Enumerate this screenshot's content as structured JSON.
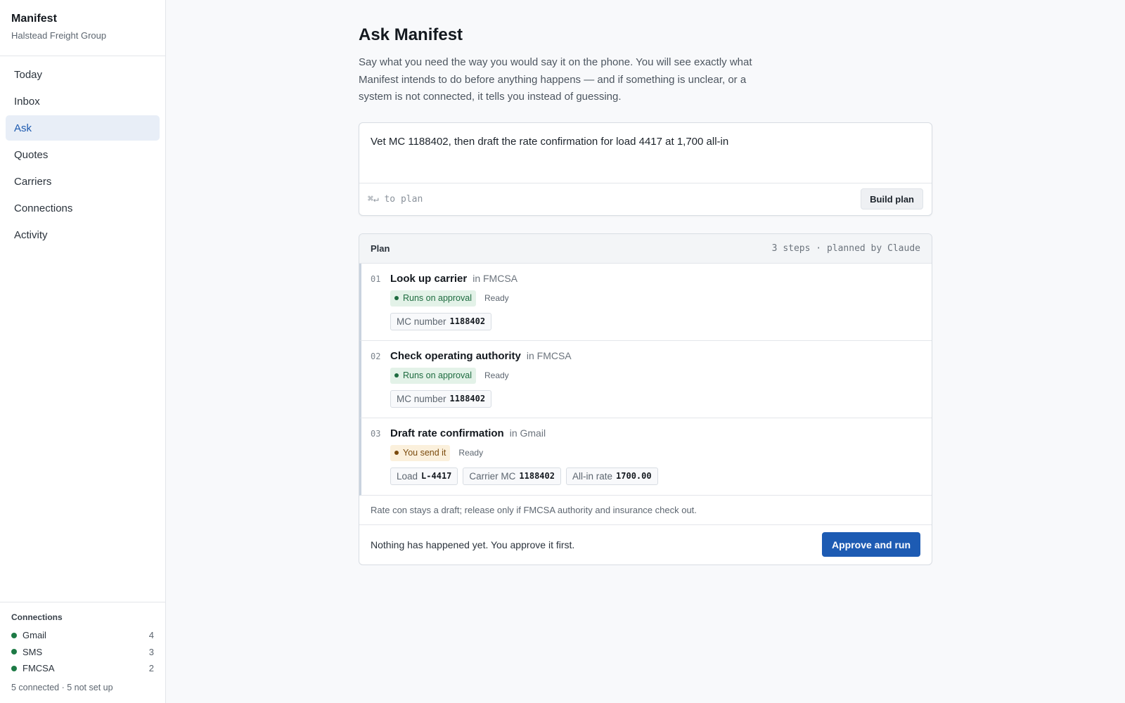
{
  "app": {
    "name": "Manifest",
    "org": "Halstead Freight Group"
  },
  "sidebar": {
    "items": [
      {
        "label": "Today"
      },
      {
        "label": "Inbox"
      },
      {
        "label": "Ask",
        "active": true
      },
      {
        "label": "Quotes"
      },
      {
        "label": "Carriers"
      },
      {
        "label": "Connections"
      },
      {
        "label": "Activity"
      }
    ],
    "connections": {
      "title": "Connections",
      "items": [
        {
          "name": "Gmail",
          "count": "4",
          "status_color": "#1d7a45"
        },
        {
          "name": "SMS",
          "count": "3",
          "status_color": "#1d7a45"
        },
        {
          "name": "FMCSA",
          "count": "2",
          "status_color": "#1d7a45"
        }
      ],
      "summary": "5 connected · 5 not set up"
    }
  },
  "main": {
    "title": "Ask Manifest",
    "intro": "Say what you need the way you would say it on the phone. You will see exactly what Manifest intends to do before anything happens — and if something is unclear, or a system is not connected, it tells you instead of guessing.",
    "composer": {
      "value": "Vet MC 1188402, then draft the rate confirmation for load 4417 at 1,700 all-in",
      "hint": "⌘↵ to plan",
      "button": "Build plan"
    },
    "plan": {
      "title": "Plan",
      "meta": "3 steps · planned by Claude",
      "steps": [
        {
          "num": "01",
          "title": "Look up carrier",
          "system": "in FMCSA",
          "badge": "Runs on approval",
          "badge_tone": "green",
          "state": "Ready",
          "params": [
            {
              "label": "MC number",
              "value": "1188402"
            }
          ]
        },
        {
          "num": "02",
          "title": "Check operating authority",
          "system": "in FMCSA",
          "badge": "Runs on approval",
          "badge_tone": "green",
          "state": "Ready",
          "params": [
            {
              "label": "MC number",
              "value": "1188402"
            }
          ]
        },
        {
          "num": "03",
          "title": "Draft rate confirmation",
          "system": "in Gmail",
          "badge": "You send it",
          "badge_tone": "amber",
          "state": "Ready",
          "params": [
            {
              "label": "Load",
              "value": "L-4417"
            },
            {
              "label": "Carrier MC",
              "value": "1188402"
            },
            {
              "label": "All-in rate",
              "value": "1700.00"
            }
          ]
        }
      ],
      "note": "Rate con stays a draft; release only if FMCSA authority and insurance check out.",
      "footer_text": "Nothing has happened yet. You approve it first.",
      "approve_button": "Approve and run"
    }
  },
  "colors": {
    "accent": "#1d5bb3",
    "active_nav_bg": "#e8eef7",
    "connected": "#1d7a45",
    "green_badge": "#1d6b3f",
    "amber_badge": "#7a4a0c"
  }
}
